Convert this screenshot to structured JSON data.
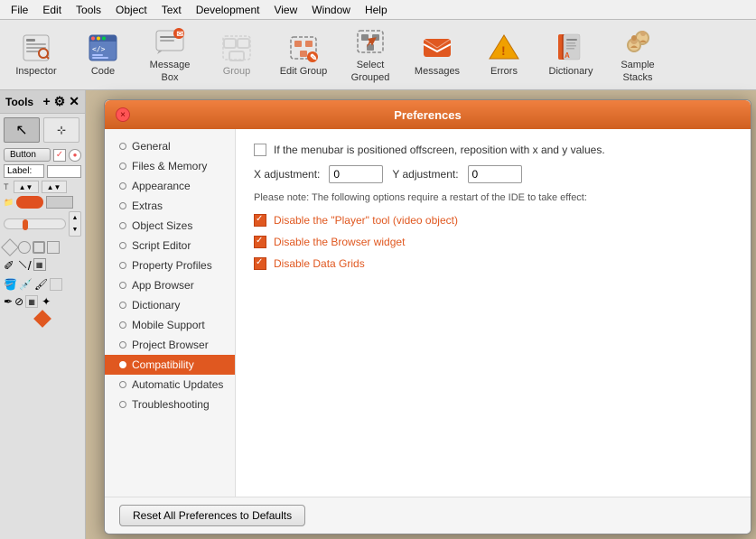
{
  "menubar": {
    "items": [
      "File",
      "Edit",
      "Tools",
      "Object",
      "Text",
      "Development",
      "View",
      "Window",
      "Help"
    ]
  },
  "toolbar": {
    "buttons": [
      {
        "id": "inspector",
        "label": "Inspector",
        "icon": "inspector-icon"
      },
      {
        "id": "code",
        "label": "Code",
        "icon": "code-icon"
      },
      {
        "id": "message-box",
        "label": "Message Box",
        "icon": "msgbox-icon"
      },
      {
        "id": "group",
        "label": "Group",
        "icon": "group-icon",
        "disabled": true
      },
      {
        "id": "edit-group",
        "label": "Edit Group",
        "icon": "editgroup-icon"
      },
      {
        "id": "select-grouped",
        "label": "Select Grouped",
        "icon": "selectgrouped-icon"
      },
      {
        "id": "messages",
        "label": "Messages",
        "icon": "messages-icon"
      },
      {
        "id": "errors",
        "label": "Errors",
        "icon": "errors-icon"
      },
      {
        "id": "dictionary",
        "label": "Dictionary",
        "icon": "dictionary-icon"
      },
      {
        "id": "sample-stacks",
        "label": "Sample Stacks",
        "icon": "samplestacks-icon"
      }
    ]
  },
  "tools": {
    "title": "Tools",
    "icons": {
      "plus": "+",
      "gear": "⚙"
    }
  },
  "dialog": {
    "title": "Preferences",
    "close_btn_label": "×",
    "sidebar_items": [
      {
        "id": "general",
        "label": "General",
        "active": false
      },
      {
        "id": "files-memory",
        "label": "Files & Memory",
        "active": false
      },
      {
        "id": "appearance",
        "label": "Appearance",
        "active": false
      },
      {
        "id": "extras",
        "label": "Extras",
        "active": false
      },
      {
        "id": "object-sizes",
        "label": "Object Sizes",
        "active": false
      },
      {
        "id": "script-editor",
        "label": "Script Editor",
        "active": false
      },
      {
        "id": "property-profiles",
        "label": "Property Profiles",
        "active": false
      },
      {
        "id": "app-browser",
        "label": "App Browser",
        "active": false
      },
      {
        "id": "dictionary",
        "label": "Dictionary",
        "active": false
      },
      {
        "id": "mobile-support",
        "label": "Mobile Support",
        "active": false
      },
      {
        "id": "project-browser",
        "label": "Project Browser",
        "active": false
      },
      {
        "id": "compatibility",
        "label": "Compatibility",
        "active": true
      },
      {
        "id": "automatic-updates",
        "label": "Automatic Updates",
        "active": false
      },
      {
        "id": "troubleshooting",
        "label": "Troubleshooting",
        "active": false
      }
    ],
    "content": {
      "menubar_checkbox_label": "If the menubar is positioned offscreen, reposition with x and y values.",
      "menubar_checked": false,
      "x_adjustment_label": "X adjustment:",
      "x_adjustment_value": "0",
      "y_adjustment_label": "Y adjustment:",
      "y_adjustment_value": "0",
      "restart_note": "Please note: The following options require a restart of the IDE to take effect:",
      "options": [
        {
          "id": "disable-player",
          "label": "Disable the \"Player\" tool (video object)",
          "checked": true
        },
        {
          "id": "disable-browser",
          "label": "Disable the Browser widget",
          "checked": true
        },
        {
          "id": "disable-datagrids",
          "label": "Disable Data Grids",
          "checked": true
        }
      ]
    },
    "footer": {
      "reset_label": "Reset All Preferences to Defaults"
    }
  }
}
